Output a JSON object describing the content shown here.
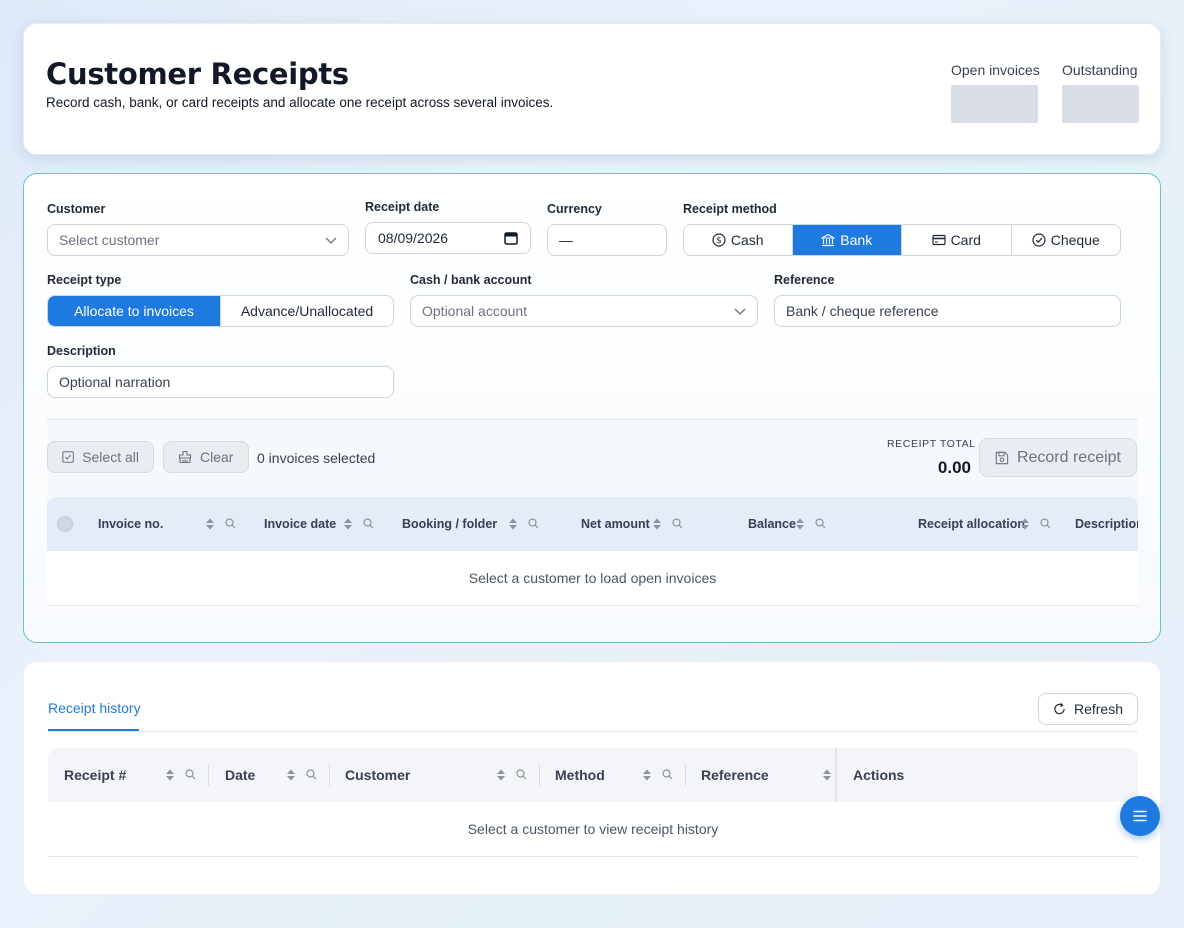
{
  "header": {
    "title": "Customer Receipts",
    "subtitle": "Record cash, bank, or card receipts and allocate one receipt across several invoices.",
    "stats": [
      {
        "label": "Open invoices"
      },
      {
        "label": "Outstanding"
      }
    ]
  },
  "form": {
    "customer": {
      "label": "Customer",
      "placeholder": "Select customer"
    },
    "receipt_date": {
      "label": "Receipt date",
      "value": "08/09/2026"
    },
    "currency": {
      "label": "Currency",
      "value": "—"
    },
    "receipt_method": {
      "label": "Receipt method",
      "options": [
        "Cash",
        "Bank",
        "Card",
        "Cheque"
      ],
      "selected": "Bank"
    },
    "receipt_type": {
      "label": "Receipt type",
      "options": [
        "Allocate to invoices",
        "Advance/Unallocated"
      ],
      "selected": "Allocate to invoices"
    },
    "account": {
      "label": "Cash / bank account",
      "placeholder": "Optional account"
    },
    "reference": {
      "label": "Reference",
      "placeholder": "Bank / cheque reference"
    },
    "description": {
      "label": "Description",
      "placeholder": "Optional narration"
    }
  },
  "allocation": {
    "select_all_label": "Select all",
    "clear_label": "Clear",
    "selected_count_text": "0 invoices selected",
    "total_label": "RECEIPT TOTAL",
    "total_value": "0.00",
    "record_label": "Record receipt",
    "columns": [
      "Invoice no.",
      "Invoice date",
      "Booking / folder",
      "Net amount",
      "Balance",
      "Receipt allocation",
      "Description"
    ],
    "empty_text": "Select a customer to load open invoices"
  },
  "history": {
    "tab_label": "Receipt history",
    "refresh_label": "Refresh",
    "columns": [
      "Receipt #",
      "Date",
      "Customer",
      "Method",
      "Reference",
      "Actions"
    ],
    "empty_text": "Select a customer to view receipt history"
  },
  "colors": {
    "accent": "#1f7ae0",
    "form_border": "#66c3cc"
  }
}
